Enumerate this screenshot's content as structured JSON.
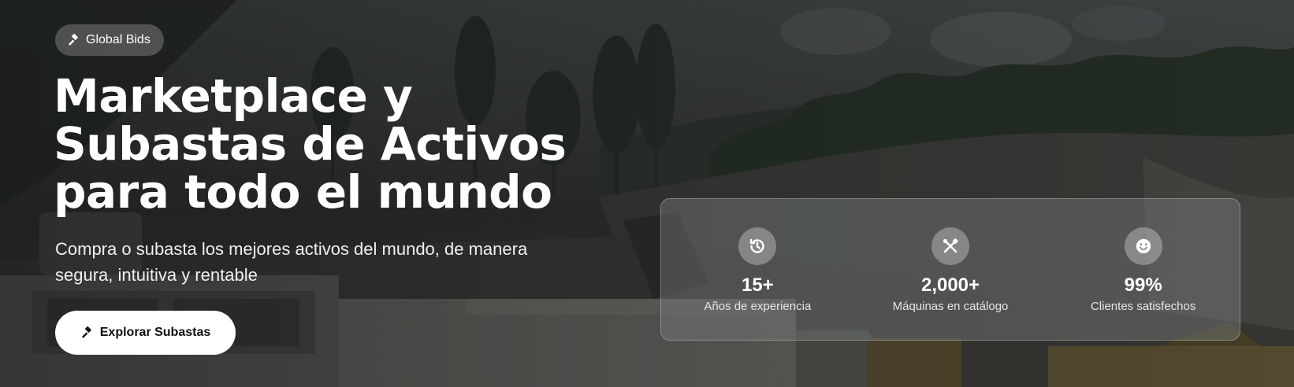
{
  "badge": {
    "icon": "gavel-icon",
    "label": "Global Bids"
  },
  "hero": {
    "title_lines": [
      "Marketplace y",
      "Subastas de Activos",
      "para todo el mundo"
    ],
    "subtitle": "Compra o subasta los mejores activos del mundo, de manera segura, intuitiva y rentable",
    "cta": {
      "icon": "gavel-icon",
      "label": "Explorar Subastas"
    }
  },
  "stats": [
    {
      "icon": "history-icon",
      "value": "15+",
      "label": "Años de experiencia"
    },
    {
      "icon": "tools-icon",
      "value": "2,000+",
      "label": "Máquinas en catálogo"
    },
    {
      "icon": "smile-icon",
      "value": "99%",
      "label": "Clientes satisfechos"
    }
  ],
  "colors": {
    "text": "#ffffff",
    "button_bg": "#ffffff",
    "button_text": "#111111"
  }
}
